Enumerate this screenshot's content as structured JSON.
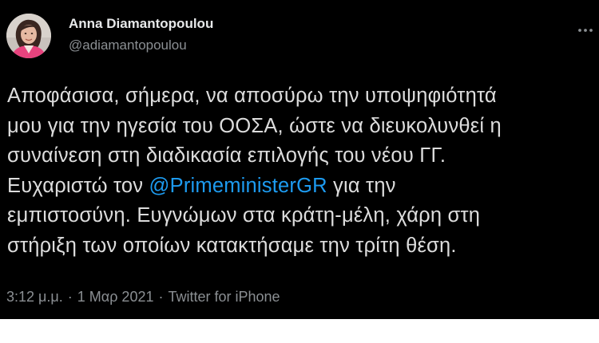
{
  "tweet": {
    "author": {
      "name": "Anna Diamantopoulou",
      "handle": "@adiamantopoulou",
      "avatar_icon": "profile-photo"
    },
    "text_lines": [
      "Αποφάσισα, σήμερα, να αποσύρω την υποψηφιότητά",
      "μου για την ηγεσία του ΟΟΣΑ, ώστε να διευκολυνθεί η",
      "συναίνεση στη διαδικασία επιλογής του νέου ΓΓ."
    ],
    "line4_before": "Ευχαριστώ τον ",
    "mention": "@PrimeministerGR",
    "line4_after": " για την",
    "text_lines_end": [
      "εμπιστοσύνη. Ευγνώμων στα κράτη-μέλη, χάρη στη",
      "στήριξη των οποίων κατακτήσαμε την τρίτη θέση."
    ],
    "time": "3:12 μ.μ.",
    "separator": "·",
    "date": "1 Μαρ 2021",
    "source": "Twitter for iPhone"
  },
  "colors": {
    "background": "#000000",
    "link": "#1d9bf0",
    "secondary_text": "#8b8f93"
  }
}
